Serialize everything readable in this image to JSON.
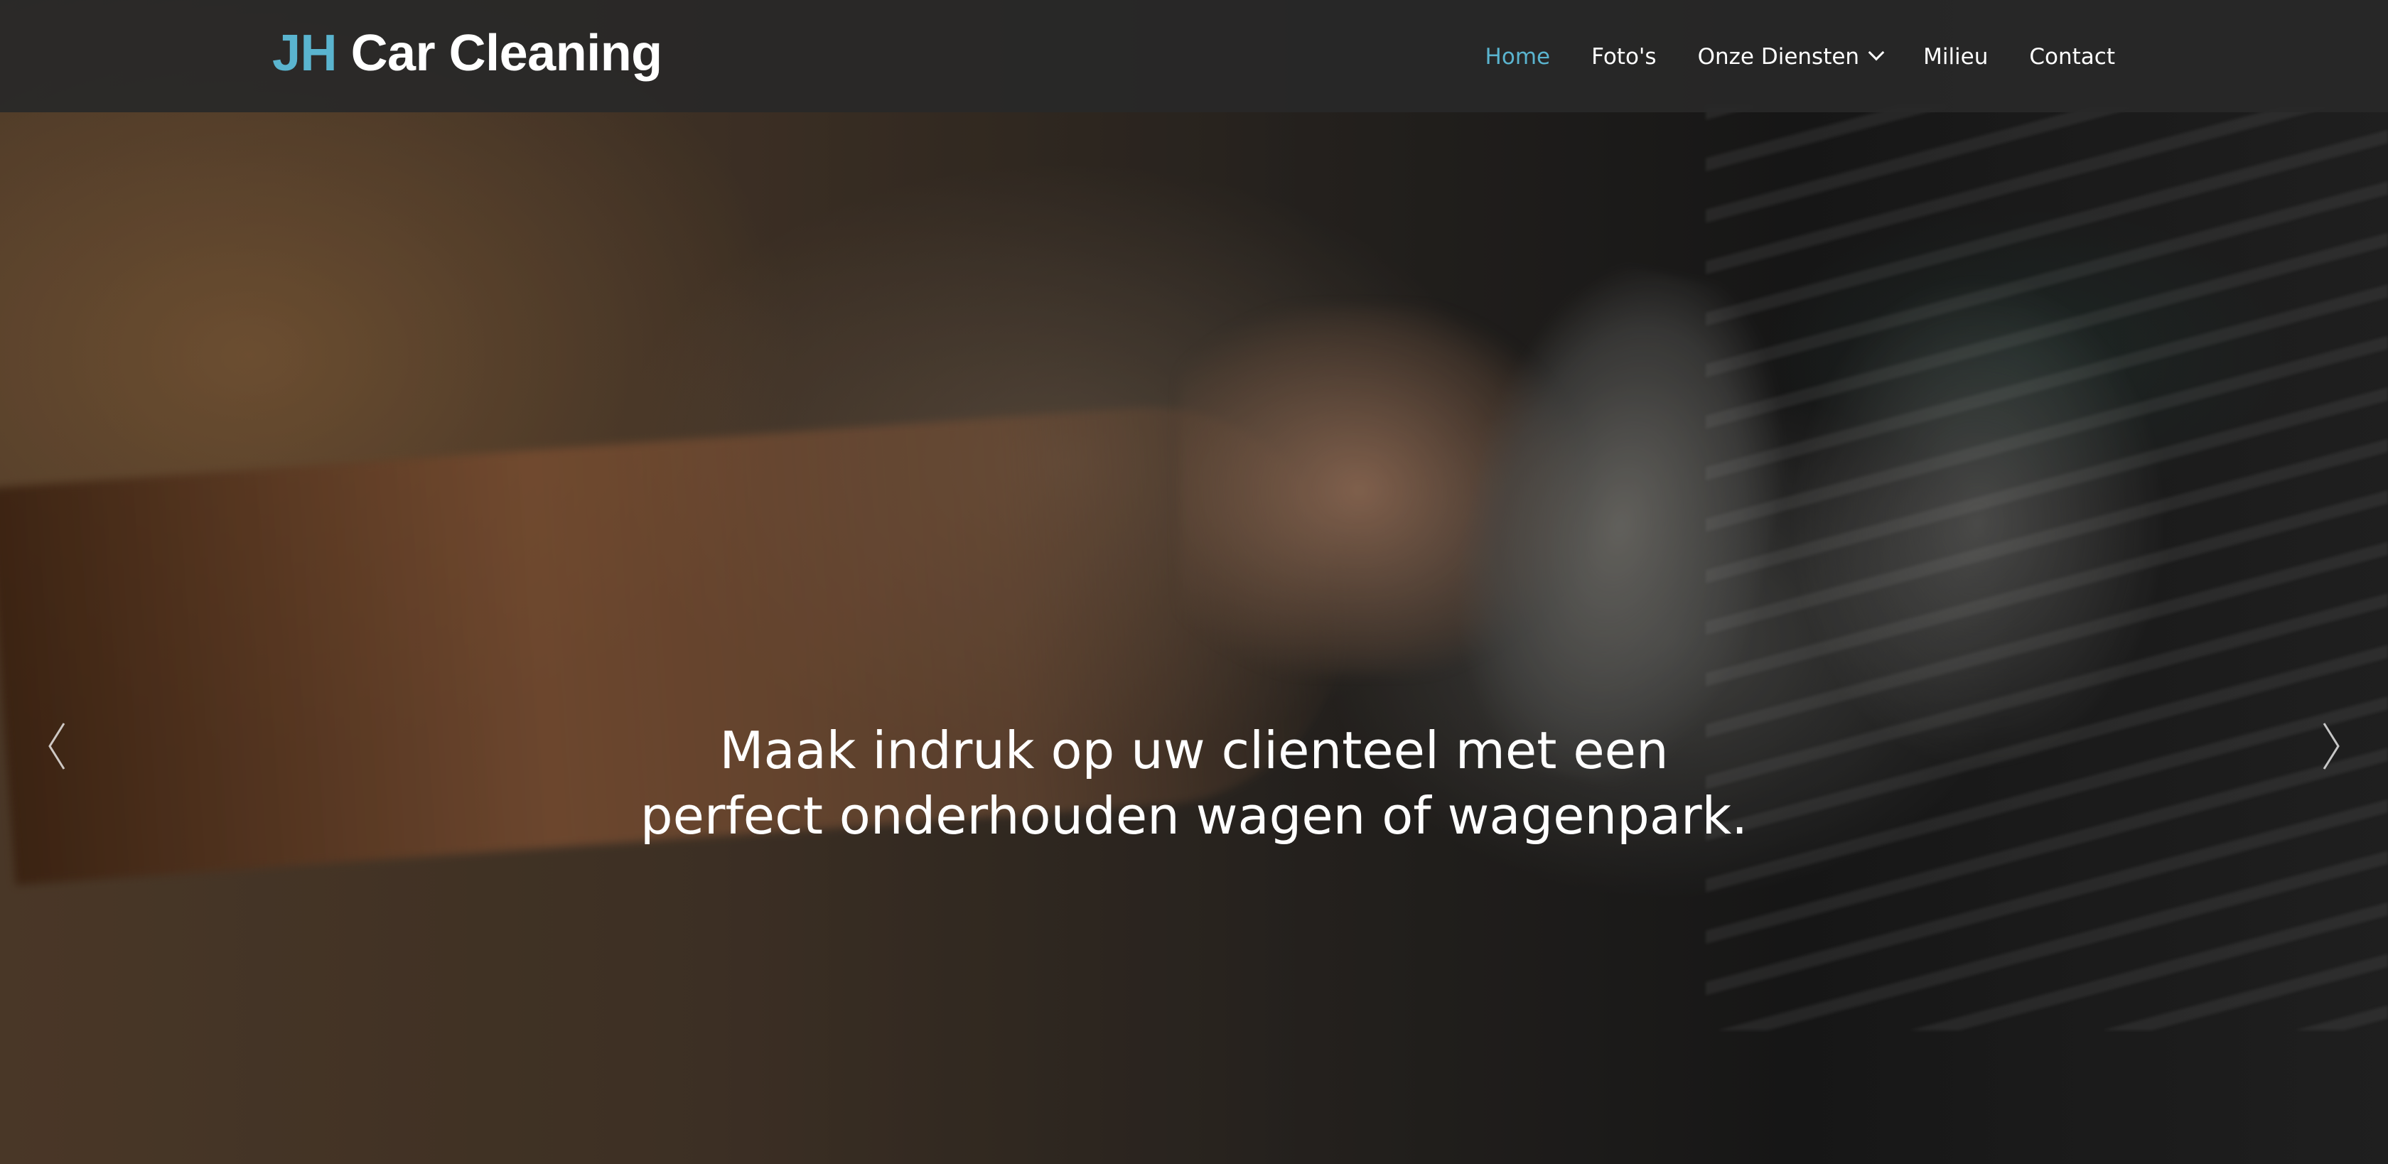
{
  "brand": {
    "accent": "JH",
    "name": "Car Cleaning"
  },
  "nav": {
    "items": [
      {
        "label": "Home",
        "active": true
      },
      {
        "label": "Foto's",
        "active": false
      },
      {
        "label": "Onze Diensten",
        "active": false,
        "dropdown": true
      },
      {
        "label": "Milieu",
        "active": false
      },
      {
        "label": "Contact",
        "active": false
      }
    ]
  },
  "hero": {
    "caption_line1": "Maak indruk op uw clienteel met een",
    "caption_line2": "perfect onderhouden wagen of wagenpark."
  },
  "icons": {
    "prev": "chevron-left-icon",
    "next": "chevron-right-icon",
    "dropdown": "chevron-down-icon"
  },
  "colors": {
    "accent": "#5ab4cf",
    "navbar": "#282828",
    "text": "#ffffff"
  }
}
